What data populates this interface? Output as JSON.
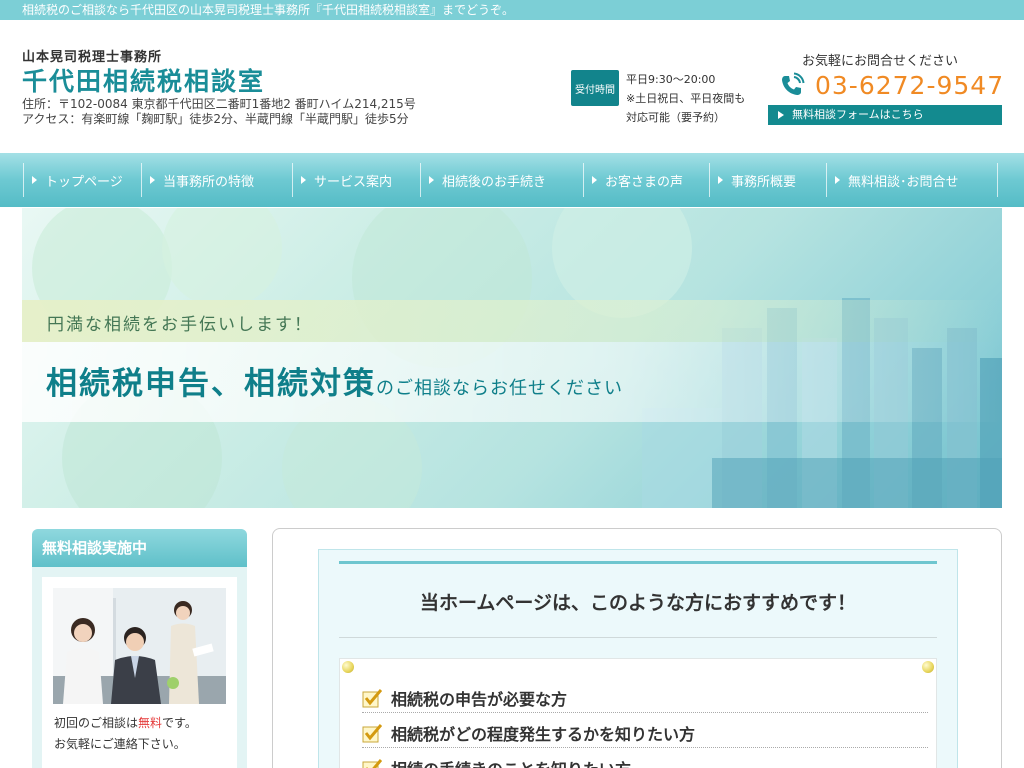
{
  "top_strip": {
    "text": "相続税のご相談なら千代田区の山本晃司税理士事務所『千代田相続税相談室』までどうぞ。"
  },
  "header": {
    "office_name": "山本晃司税理士事務所",
    "site_title": "千代田相続税相談室",
    "address_line1": "住所：〒102-0084 東京都千代田区二番町1番地2 番町ハイム214,215号",
    "address_line2": "アクセス：有楽町線「麹町駅」徒歩2分、半蔵門線「半蔵門駅」徒歩5分",
    "hours_badge": "受付時間",
    "hours_line1": "平日9:30〜20:00",
    "hours_line2": "※土日祝日、平日夜間も",
    "hours_line3": "対応可能（要予約）",
    "contact_lead": "お気軽にお問合せください",
    "phone": "03-6272-9547",
    "form_link": "無料相談フォームはこちら"
  },
  "nav": {
    "items": [
      {
        "label": "トップページ",
        "width": 118
      },
      {
        "label": "当事務所の特徴",
        "width": 151
      },
      {
        "label": "サービス案内",
        "width": 128
      },
      {
        "label": "相続後のお手続き",
        "width": 163
      },
      {
        "label": "お客さまの声",
        "width": 126
      },
      {
        "label": "事務所概要",
        "width": 117
      },
      {
        "label": "無料相談･お問合せ",
        "width": 171
      }
    ]
  },
  "hero": {
    "subtitle": "円満な相続をお手伝いします！",
    "headline": "相続税申告、相続対策",
    "headline_suffix": "のご相談ならお任せください"
  },
  "sidebar": {
    "title": "無料相談実施中",
    "text_pre": "初回のご相談は",
    "text_red": "無料",
    "text_post": "です。",
    "text_line2": "お気軽にご連絡下さい。"
  },
  "main": {
    "title": "当ホームページは、このような方におすすめです！",
    "items": [
      "相続税の申告が必要な方",
      "相続税がどの程度発生するかを知りたい方",
      "相続の手続きのことを知りたい方"
    ]
  },
  "colors": {
    "accent": "#1a8d98",
    "phone": "#f08a24",
    "nav": "#6dc9d2",
    "free_red": "#e53a3a"
  }
}
